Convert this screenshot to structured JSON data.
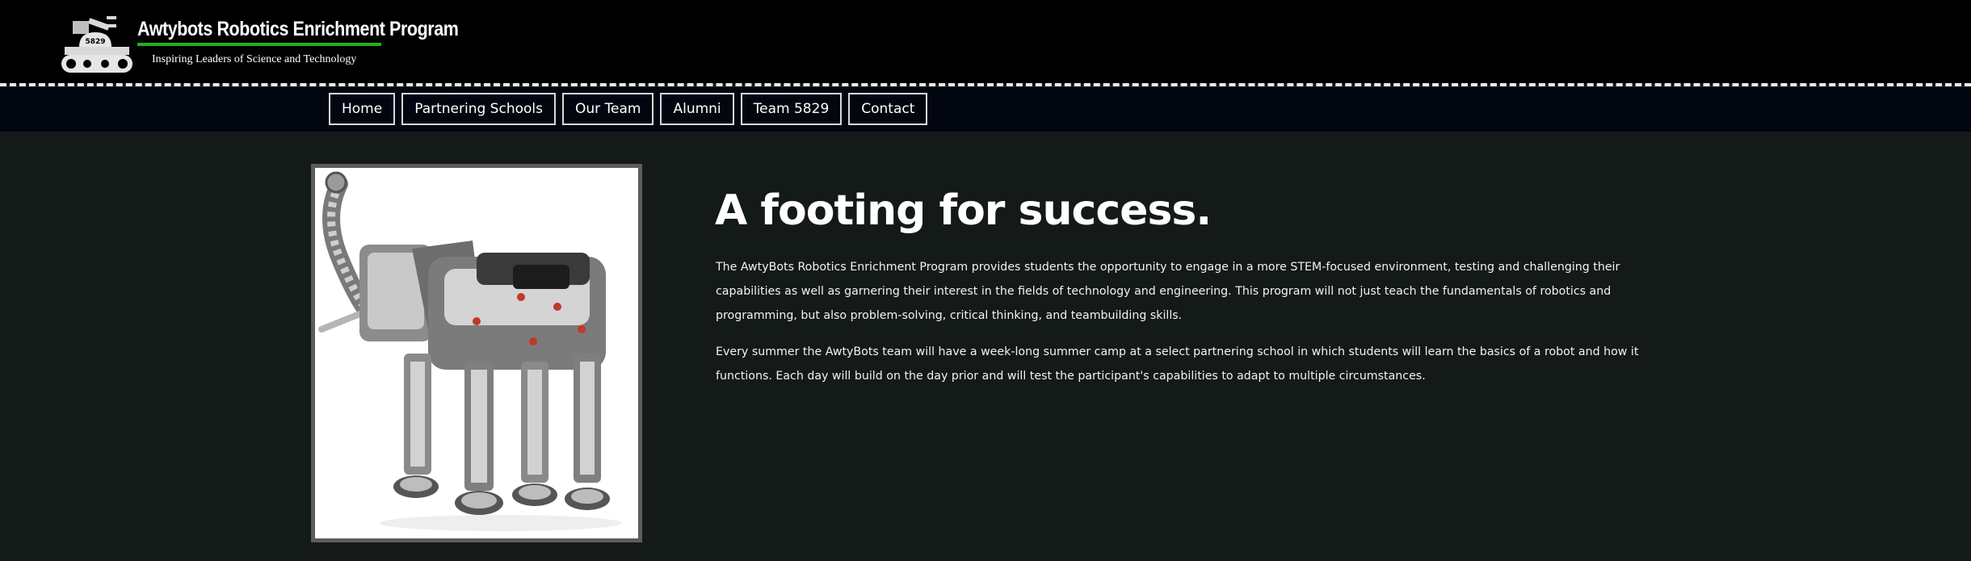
{
  "header": {
    "brand_title": "Awtybots Robotics Enrichment Program",
    "tagline": "Inspiring Leaders of Science and Technology",
    "logo_badge": "5829",
    "accent_color": "#1fb317"
  },
  "nav": {
    "items": [
      "Home",
      "Partnering Schools",
      "Our Team",
      "Alumni",
      "Team 5829",
      "Contact"
    ]
  },
  "main": {
    "image_subject": "robot-elephant-photo",
    "headline": "A footing for success.",
    "paragraph1": "The AwtyBots Robotics Enrichment Program provides students the opportunity to engage in a more STEM-focused environment, testing and challenging their capabilities as well as garnering their interest in the fields of technology and engineering. This program will not just teach the fundamentals of robotics and programming, but also problem-solving, critical thinking, and teambuilding skills.",
    "paragraph2": "Every summer the AwtyBots team will have a week-long summer camp at a select partnering school in which students will learn the basics of a robot and how it functions. Each day will build on the day prior and will test the participant's capabilities to adapt to multiple circumstances."
  }
}
